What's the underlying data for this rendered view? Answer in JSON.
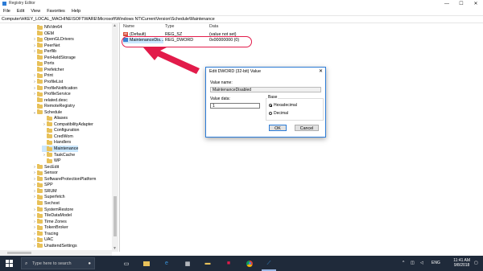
{
  "window": {
    "title": "Registry Editor",
    "minimize": "—",
    "maximize": "☐",
    "close": "✕"
  },
  "menu": [
    "File",
    "Edit",
    "View",
    "Favorites",
    "Help"
  ],
  "address": "Computer\\HKEY_LOCAL_MACHINE\\SOFTWARE\\Microsoft\\Windows NT\\CurrentVersion\\Schedule\\Maintenance",
  "tree": [
    {
      "label": "NtVdm64",
      "chev": "",
      "indent": 0
    },
    {
      "label": "OEM",
      "chev": "",
      "indent": 0
    },
    {
      "label": "OpenGLDrivers",
      "chev": "›",
      "indent": 0
    },
    {
      "label": "PeerNet",
      "chev": "›",
      "indent": 0
    },
    {
      "label": "Perflib",
      "chev": "›",
      "indent": 0
    },
    {
      "label": "PerHwIdStorage",
      "chev": "",
      "indent": 0
    },
    {
      "label": "Ports",
      "chev": "",
      "indent": 0
    },
    {
      "label": "Prefetcher",
      "chev": "",
      "indent": 0
    },
    {
      "label": "Print",
      "chev": "›",
      "indent": 0
    },
    {
      "label": "ProfileList",
      "chev": "›",
      "indent": 0
    },
    {
      "label": "ProfileNotification",
      "chev": "›",
      "indent": 0
    },
    {
      "label": "ProfileService",
      "chev": "›",
      "indent": 0
    },
    {
      "label": "related.desc",
      "chev": "",
      "indent": 0
    },
    {
      "label": "RemoteRegistry",
      "chev": "",
      "indent": 0
    },
    {
      "label": "Schedule",
      "chev": "⌄",
      "indent": 0
    },
    {
      "label": "Aliases",
      "chev": "",
      "indent": 1
    },
    {
      "label": "CompatibilityAdapter",
      "chev": "›",
      "indent": 1
    },
    {
      "label": "Configuration",
      "chev": "",
      "indent": 1
    },
    {
      "label": "CredWom",
      "chev": "",
      "indent": 1
    },
    {
      "label": "Handlers",
      "chev": "",
      "indent": 1
    },
    {
      "label": "Maintenance",
      "chev": "",
      "indent": 1,
      "selected": true
    },
    {
      "label": "TaskCache",
      "chev": "›",
      "indent": 1
    },
    {
      "label": "WP",
      "chev": "",
      "indent": 1
    },
    {
      "label": "SecEdit",
      "chev": "›",
      "indent": 0
    },
    {
      "label": "Sensor",
      "chev": "›",
      "indent": 0
    },
    {
      "label": "SoftwareProtectionPlatform",
      "chev": "›",
      "indent": 0
    },
    {
      "label": "SPP",
      "chev": "›",
      "indent": 0
    },
    {
      "label": "SRUM",
      "chev": "›",
      "indent": 0
    },
    {
      "label": "Superfetch",
      "chev": "›",
      "indent": 0
    },
    {
      "label": "Svchost",
      "chev": "",
      "indent": 0
    },
    {
      "label": "SystemRestore",
      "chev": "›",
      "indent": 0
    },
    {
      "label": "TileDataModel",
      "chev": "›",
      "indent": 0
    },
    {
      "label": "Time Zones",
      "chev": "›",
      "indent": 0
    },
    {
      "label": "TokenBroker",
      "chev": "›",
      "indent": 0
    },
    {
      "label": "Tracing",
      "chev": "›",
      "indent": 0
    },
    {
      "label": "UAC",
      "chev": "›",
      "indent": 0
    },
    {
      "label": "UnattendSettings",
      "chev": "›",
      "indent": 0
    }
  ],
  "list": {
    "headers": {
      "name": "Name",
      "type": "Type",
      "data": "Data"
    },
    "rows": [
      {
        "name": "(Default)",
        "type": "REG_SZ",
        "data": "(value not set)",
        "icon": "ab"
      },
      {
        "name": "MaintenanceDis...",
        "type": "REG_DWORD",
        "data": "0x00000000 (0)",
        "icon": "bin"
      }
    ]
  },
  "dialog": {
    "title": "Edit DWORD (32-bit) Value",
    "close": "✕",
    "value_name_label": "Value name:",
    "value_name": "MaintenanceDisabled",
    "value_data_label": "Value data:",
    "value_data": "1",
    "base_label": "Base",
    "hex_label": "Hexadecimal",
    "dec_label": "Decimal",
    "ok": "OK",
    "cancel": "Cancel"
  },
  "taskbar": {
    "search_placeholder": "Type here to search",
    "time": "11:41 AM",
    "date": "9/8/2018",
    "lang": "ENG"
  },
  "colors": {
    "annotation": "#e21b4a",
    "accent": "#2b7bd6",
    "taskbar": "#1f2a3a"
  }
}
